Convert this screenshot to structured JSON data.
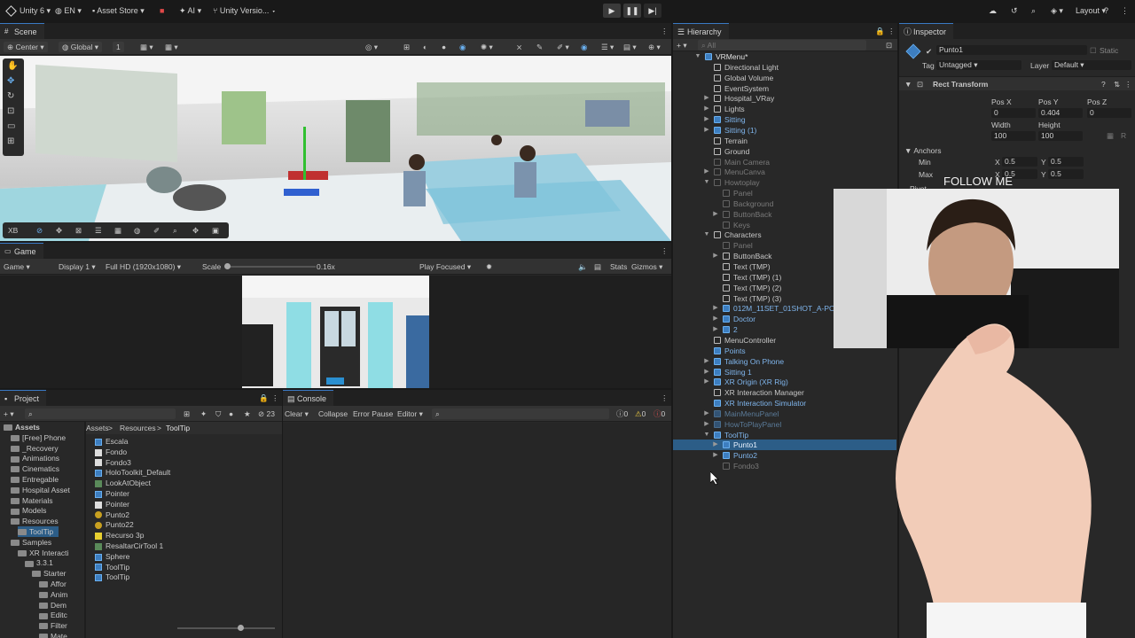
{
  "toolbar": {
    "app": "Unity 6",
    "lang": "EN",
    "asset_store": "Asset Store",
    "ai": "AI",
    "version": "Unity Versio...",
    "layout": "Layout"
  },
  "scene": {
    "tab": "Scene",
    "pivot": "Center",
    "space": "Global",
    "grid_value": "1",
    "orient_label": "XB"
  },
  "game": {
    "tab": "Game",
    "mode": "Game",
    "display": "Display 1",
    "resolution": "Full HD (1920x1080)",
    "scale_label": "Scale",
    "scale_value": "0.16x",
    "play_focused": "Play Focused",
    "stats": "Stats",
    "gizmos": "Gizmos"
  },
  "hierarchy": {
    "tab": "Hierarchy",
    "search_placeholder": "All",
    "items": [
      {
        "label": "VRMenu*",
        "depth": 0,
        "arrow": "▼",
        "style": "root"
      },
      {
        "label": "Directional Light",
        "depth": 1,
        "arrow": "",
        "style": "normal"
      },
      {
        "label": "Global Volume",
        "depth": 1,
        "arrow": "",
        "style": "normal"
      },
      {
        "label": "EventSystem",
        "depth": 1,
        "arrow": "",
        "style": "normal"
      },
      {
        "label": "Hospital_VRay",
        "depth": 1,
        "arrow": "▶",
        "style": "normal"
      },
      {
        "label": "Lights",
        "depth": 1,
        "arrow": "▶",
        "style": "normal"
      },
      {
        "label": "Sitting",
        "depth": 1,
        "arrow": "▶",
        "style": "blue"
      },
      {
        "label": "Sitting (1)",
        "depth": 1,
        "arrow": "▶",
        "style": "blue"
      },
      {
        "label": "Terrain",
        "depth": 1,
        "arrow": "",
        "style": "normal"
      },
      {
        "label": "Ground",
        "depth": 1,
        "arrow": "",
        "style": "normal"
      },
      {
        "label": "Main Camera",
        "depth": 1,
        "arrow": "",
        "style": "dim"
      },
      {
        "label": "MenuCanva",
        "depth": 1,
        "arrow": "▶",
        "style": "dim"
      },
      {
        "label": "Howtoplay",
        "depth": 1,
        "arrow": "▼",
        "style": "dim"
      },
      {
        "label": "Panel",
        "depth": 2,
        "arrow": "",
        "style": "dim"
      },
      {
        "label": "Background",
        "depth": 2,
        "arrow": "",
        "style": "dim"
      },
      {
        "label": "ButtonBack",
        "depth": 2,
        "arrow": "▶",
        "style": "dim"
      },
      {
        "label": "Keys",
        "depth": 2,
        "arrow": "",
        "style": "dim"
      },
      {
        "label": "Characters",
        "depth": 1,
        "arrow": "▼",
        "style": "normal"
      },
      {
        "label": "Panel",
        "depth": 2,
        "arrow": "",
        "style": "dim"
      },
      {
        "label": "ButtonBack",
        "depth": 2,
        "arrow": "▶",
        "style": "normal"
      },
      {
        "label": "Text (TMP)",
        "depth": 2,
        "arrow": "",
        "style": "normal"
      },
      {
        "label": "Text (TMP) (1)",
        "depth": 2,
        "arrow": "",
        "style": "normal"
      },
      {
        "label": "Text (TMP) (2)",
        "depth": 2,
        "arrow": "",
        "style": "normal"
      },
      {
        "label": "Text (TMP) (3)",
        "depth": 2,
        "arrow": "",
        "style": "normal"
      },
      {
        "label": "012M_11SET_01SHOT_A-POSE",
        "depth": 2,
        "arrow": "▶",
        "style": "blue"
      },
      {
        "label": "Doctor",
        "depth": 2,
        "arrow": "▶",
        "style": "blue"
      },
      {
        "label": "2",
        "depth": 2,
        "arrow": "▶",
        "style": "blue"
      },
      {
        "label": "MenuController",
        "depth": 1,
        "arrow": "",
        "style": "normal"
      },
      {
        "label": "Points",
        "depth": 1,
        "arrow": "",
        "style": "blue"
      },
      {
        "label": "Talking On Phone",
        "depth": 1,
        "arrow": "▶",
        "style": "blue"
      },
      {
        "label": "Sitting 1",
        "depth": 1,
        "arrow": "▶",
        "style": "blue"
      },
      {
        "label": "XR Origin (XR Rig)",
        "depth": 1,
        "arrow": "▶",
        "style": "blue"
      },
      {
        "label": "XR Interaction Manager",
        "depth": 1,
        "arrow": "",
        "style": "normal"
      },
      {
        "label": "XR Interaction Simulator",
        "depth": 1,
        "arrow": "",
        "style": "blue"
      },
      {
        "label": "MainMenuPanel",
        "depth": 1,
        "arrow": "▶",
        "style": "dimblue"
      },
      {
        "label": "HowToPlayPanel",
        "depth": 1,
        "arrow": "▶",
        "style": "dimblue"
      },
      {
        "label": "ToolTip",
        "depth": 1,
        "arrow": "▼",
        "style": "blue"
      },
      {
        "label": "Punto1",
        "depth": 2,
        "arrow": "▶",
        "style": "selected"
      },
      {
        "label": "Punto2",
        "depth": 2,
        "arrow": "▶",
        "style": "blue"
      },
      {
        "label": "Fondo3",
        "depth": 2,
        "arrow": "",
        "style": "dim"
      }
    ]
  },
  "inspector": {
    "tab": "Inspector",
    "object_name": "Punto1",
    "static_label": "Static",
    "tag_label": "Tag",
    "tag_value": "Untagged",
    "layer_label": "Layer",
    "layer_value": "Default",
    "component": "Rect Transform",
    "posx_label": "Pos X",
    "posy_label": "Pos Y",
    "posz_label": "Pos Z",
    "posx": "0",
    "posy": "0.404",
    "posz": "0",
    "width_label": "Width",
    "height_label": "Height",
    "width": "100",
    "height": "100",
    "anchors_label": "Anchors",
    "min_label": "Min",
    "max_label": "Max",
    "min_x": "0.5",
    "min_y": "0.5",
    "max_x": "0.5",
    "max_y": "0.5",
    "pivot_label": "Pivot",
    "x_label": "X",
    "y_label": "Y"
  },
  "project": {
    "tab": "Project",
    "count": "23",
    "breadcrumb": [
      "Assets",
      "Resources",
      "ToolTip"
    ],
    "tree": [
      {
        "label": "Assets",
        "indent": 0,
        "bold": true
      },
      {
        "label": "[Free] Phone",
        "indent": 1
      },
      {
        "label": "_Recovery",
        "indent": 1
      },
      {
        "label": "Animations",
        "indent": 1
      },
      {
        "label": "Cinematics",
        "indent": 1
      },
      {
        "label": "Entregable",
        "indent": 1
      },
      {
        "label": "Hospital Asset",
        "indent": 1
      },
      {
        "label": "Materials",
        "indent": 1
      },
      {
        "label": "Models",
        "indent": 1
      },
      {
        "label": "Resources",
        "indent": 1
      },
      {
        "label": "ToolTip",
        "indent": 2,
        "selected": true
      },
      {
        "label": "Samples",
        "indent": 1
      },
      {
        "label": "XR Interacti",
        "indent": 2
      },
      {
        "label": "3.3.1",
        "indent": 3
      },
      {
        "label": "Starter",
        "indent": 4
      },
      {
        "label": "Affor",
        "indent": 5
      },
      {
        "label": "Anim",
        "indent": 5
      },
      {
        "label": "Dem",
        "indent": 5
      },
      {
        "label": "Editc",
        "indent": 5
      },
      {
        "label": "Filter",
        "indent": 5
      },
      {
        "label": "Mate",
        "indent": 5
      }
    ],
    "files": [
      {
        "label": "Escala",
        "icon": "prefab-icon"
      },
      {
        "label": "Fondo",
        "icon": "image-icon"
      },
      {
        "label": "Fondo3",
        "icon": "image-icon"
      },
      {
        "label": "HoloToolkit_Default",
        "icon": "prefab-icon"
      },
      {
        "label": "LookAtObject",
        "icon": "script-icon"
      },
      {
        "label": "Pointer",
        "icon": "prefab-icon"
      },
      {
        "label": "Pointer",
        "icon": "image-icon"
      },
      {
        "label": "Punto2",
        "icon": "material-icon"
      },
      {
        "label": "Punto22",
        "icon": "material-icon"
      },
      {
        "label": "Recurso 3p",
        "icon": "texture-icon"
      },
      {
        "label": "ResaltarCirTool 1",
        "icon": "script-icon"
      },
      {
        "label": "Sphere",
        "icon": "prefab-icon"
      },
      {
        "label": "ToolTip",
        "icon": "prefab-icon"
      },
      {
        "label": "ToolTip",
        "icon": "prefab-icon"
      }
    ]
  },
  "console": {
    "tab": "Console",
    "clear": "Clear",
    "collapse": "Collapse",
    "error_pause": "Error Pause",
    "editor": "Editor",
    "log_count": "0",
    "warn_count": "0",
    "error_count": "0"
  },
  "webcam": {
    "overlay_text": "FOLLOW ME"
  },
  "colors": {
    "accent": "#3a79c4",
    "selection": "#2c5d87",
    "prefab_blue": "#7fb5ec",
    "panel": "#282828"
  }
}
